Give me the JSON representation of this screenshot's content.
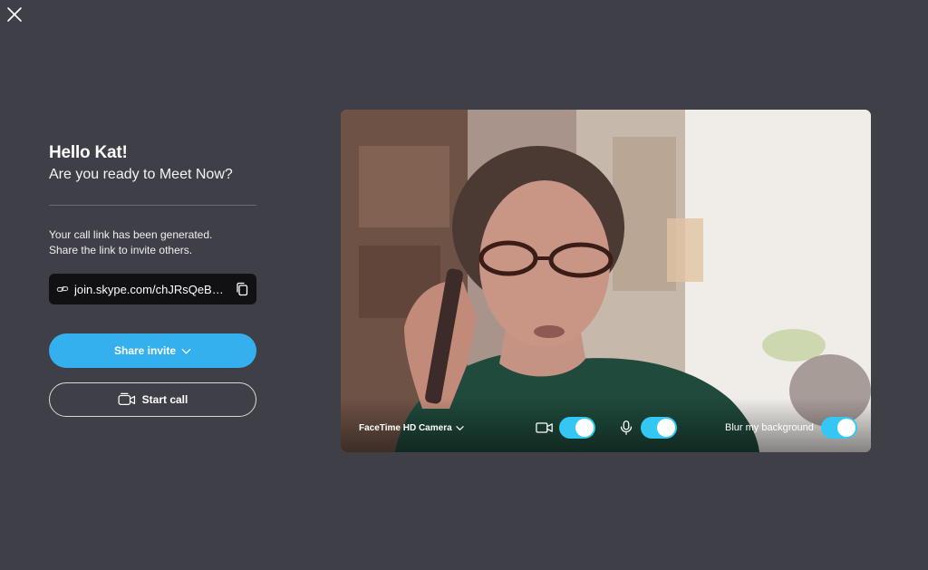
{
  "window": {
    "close_icon": "close-icon"
  },
  "intro": {
    "greeting": "Hello Kat!",
    "subtitle": "Are you ready to Meet Now?",
    "info_line1": "Your call link has been generated.",
    "info_line2": "Share the link to invite others."
  },
  "link": {
    "icon": "link-icon",
    "url": "join.skype.com/chJRsQeBgq...",
    "copy_icon": "copy-icon"
  },
  "buttons": {
    "share_label": "Share invite",
    "share_icon": "chevron-down-icon",
    "start_label": "Start call",
    "start_icon": "video-call-icon"
  },
  "preview": {
    "camera_label": "FaceTime HD Camera",
    "camera_icon": "video-camera-icon",
    "camera_on": true,
    "mic_icon": "microphone-icon",
    "mic_on": true,
    "blur_label": "Blur my background",
    "blur_on": true
  },
  "colors": {
    "background": "#3f3f47",
    "accent": "#35b0ef",
    "toggle_on": "#34c7f3",
    "link_box": "#111114"
  }
}
